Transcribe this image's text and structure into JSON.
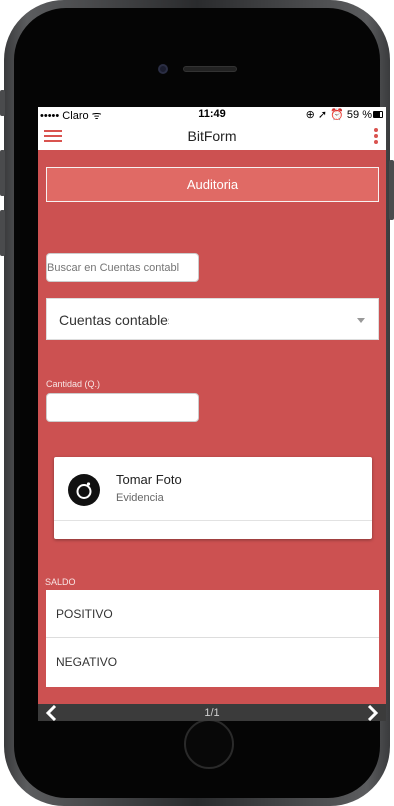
{
  "status": {
    "carrier": "••••• Claro ᯤ",
    "time": "11:49",
    "right": "⊕ ➚ ⏰ 59 %"
  },
  "app": {
    "title": "BitForm"
  },
  "form": {
    "title_button": "Auditoria",
    "search_placeholder": "Buscar en Cuentas contabl",
    "select_value": "Cuentas contables",
    "cantidad_label": "Cantidad (Q.)",
    "cantidad_value": "",
    "photo_title": "Tomar Foto",
    "photo_subtitle": "Evidencia",
    "saldo_label": "SALDO",
    "saldo_options": [
      "POSITIVO",
      "NEGATIVO"
    ]
  },
  "pager": {
    "label": "1/1"
  },
  "colors": {
    "screen_bg": "#cc5151",
    "accent": "#d9534f",
    "button_bg": "#e06a65",
    "bottom_bar": "#3b3b3b"
  },
  "icons": [
    "hamburger-icon",
    "kebab-menu-icon",
    "camera-icon",
    "chevron-left-icon",
    "chevron-right-icon",
    "dropdown-caret-icon"
  ]
}
